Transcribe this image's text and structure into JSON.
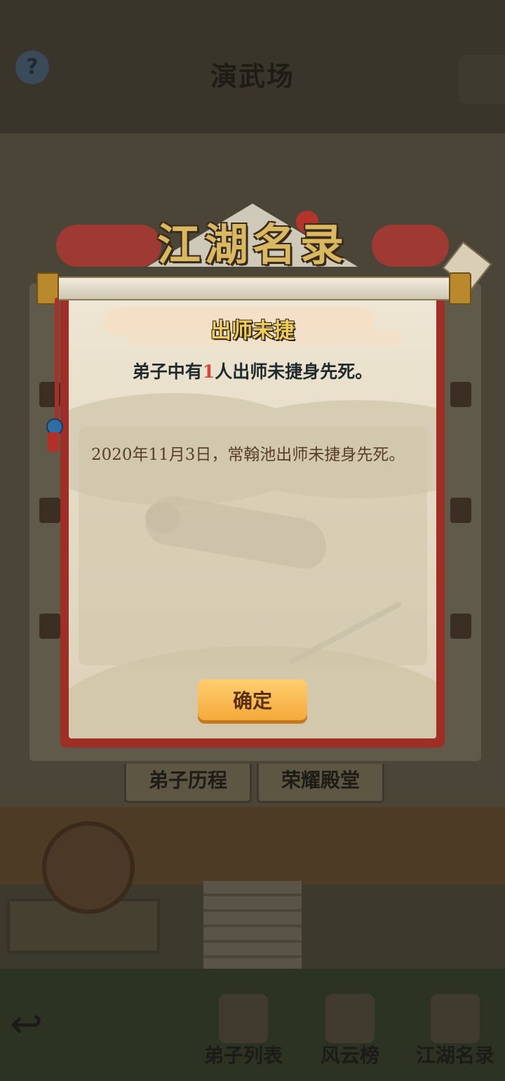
{
  "header": {
    "title": "演武场",
    "help_glyph": "?"
  },
  "modal": {
    "banner_title": "江湖名录",
    "title": "出师未捷",
    "summary_prefix": "弟子中有",
    "summary_count": "1",
    "summary_suffix": "人出师未捷身先死。",
    "records": [
      "2020年11月3日，常翰池出师未捷身先死。"
    ],
    "confirm_label": "确定"
  },
  "background_tabs": [
    "弟子历程",
    "荣耀殿堂"
  ],
  "bottom_nav": {
    "back_glyph": "↩",
    "items": [
      "弟子列表",
      "风云榜",
      "江湖名录"
    ]
  },
  "colors": {
    "accent_red": "#9e2f26",
    "button_orange": "#f4a93a",
    "title_gold": "#f0cc5c",
    "count_red": "#d24a3a"
  }
}
